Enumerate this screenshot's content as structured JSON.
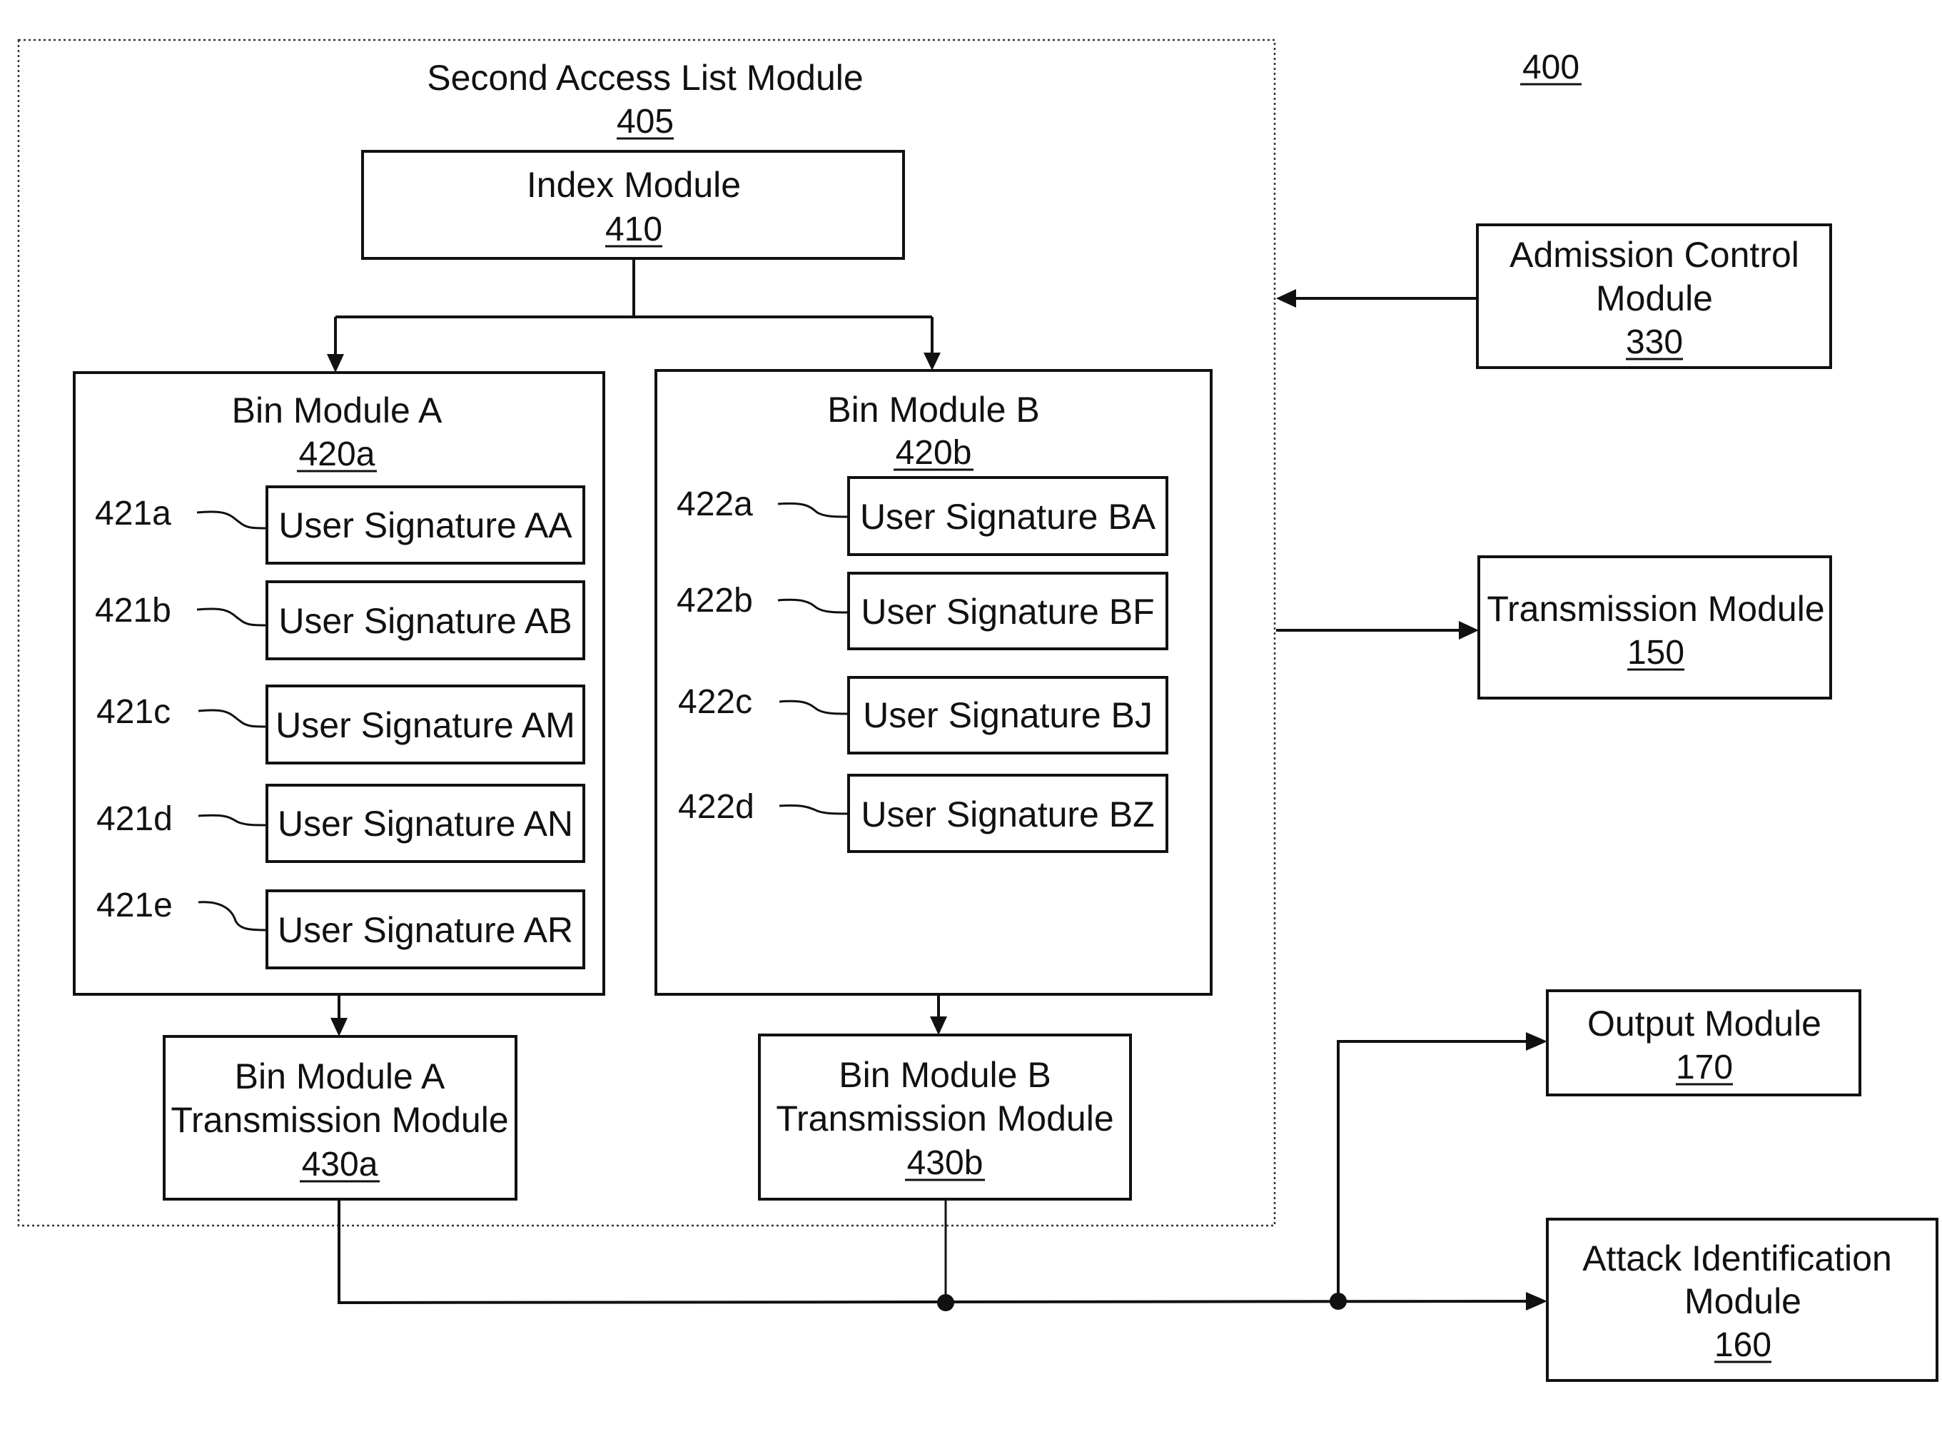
{
  "figure": {
    "number": "400"
  },
  "second_access_list_module": {
    "title": "Second Access List Module",
    "ref": "405"
  },
  "index_module": {
    "title": "Index Module",
    "ref": "410"
  },
  "bin_a": {
    "title": "Bin Module A",
    "ref": "420a",
    "signatures": [
      {
        "ref": "421a",
        "label": "User Signature AA"
      },
      {
        "ref": "421b",
        "label": "User Signature AB"
      },
      {
        "ref": "421c",
        "label": "User Signature AM"
      },
      {
        "ref": "421d",
        "label": "User Signature AN"
      },
      {
        "ref": "421e",
        "label": "User Signature AR"
      }
    ]
  },
  "bin_b": {
    "title": "Bin Module B",
    "ref": "420b",
    "signatures": [
      {
        "ref": "422a",
        "label": "User Signature BA"
      },
      {
        "ref": "422b",
        "label": "User Signature BF"
      },
      {
        "ref": "422c",
        "label": "User Signature BJ"
      },
      {
        "ref": "422d",
        "label": "User Signature BZ"
      }
    ]
  },
  "bin_a_transmission": {
    "line1": "Bin Module A",
    "line2": "Transmission Module",
    "ref": "430a"
  },
  "bin_b_transmission": {
    "line1": "Bin Module B",
    "line2": "Transmission Module",
    "ref": "430b"
  },
  "admission_control": {
    "line1": "Admission Control",
    "line2": "Module",
    "ref": "330"
  },
  "transmission_module": {
    "title": "Transmission Module",
    "ref": "150"
  },
  "output_module": {
    "title": "Output Module",
    "ref": "170"
  },
  "attack_identification": {
    "line1": "Attack Identification",
    "line2": "Module",
    "ref": "160"
  }
}
